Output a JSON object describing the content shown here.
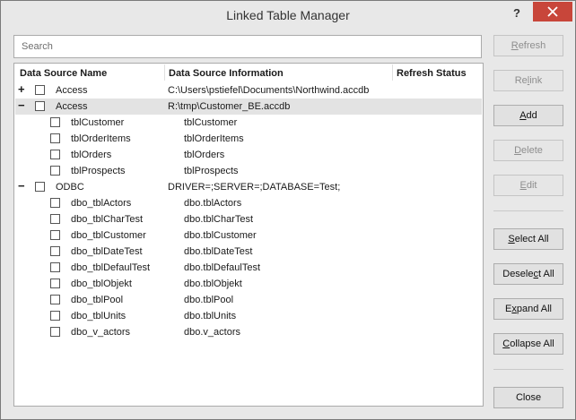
{
  "window": {
    "title": "Linked Table Manager",
    "help": "?"
  },
  "search": {
    "placeholder": "Search"
  },
  "columns": {
    "name": "Data Source Name",
    "info": "Data Source Information",
    "status": "Refresh Status"
  },
  "rows": [
    {
      "expander": "+",
      "name": "Access",
      "info": "C:\\Users\\pstiefel\\Documents\\Northwind.accdb"
    },
    {
      "expander": "−",
      "name": "Access",
      "info": "R:\\tmp\\Customer_BE.accdb",
      "selected": true
    },
    {
      "name": "tblCustomer",
      "info": "tblCustomer"
    },
    {
      "name": "tblOrderItems",
      "info": "tblOrderItems"
    },
    {
      "name": "tblOrders",
      "info": "tblOrders"
    },
    {
      "name": "tblProspects",
      "info": "tblProspects"
    },
    {
      "expander": "−",
      "name": "ODBC",
      "info": "DRIVER=;SERVER=;DATABASE=Test;"
    },
    {
      "name": "dbo_tblActors",
      "info": "dbo.tblActors"
    },
    {
      "name": "dbo_tblCharTest",
      "info": "dbo.tblCharTest"
    },
    {
      "name": "dbo_tblCustomer",
      "info": "dbo.tblCustomer"
    },
    {
      "name": "dbo_tblDateTest",
      "info": "dbo.tblDateTest"
    },
    {
      "name": "dbo_tblDefaulTest",
      "info": "dbo.tblDefaulTest"
    },
    {
      "name": "dbo_tblObjekt",
      "info": "dbo.tblObjekt"
    },
    {
      "name": "dbo_tblPool",
      "info": "dbo.tblPool"
    },
    {
      "name": "dbo_tblUnits",
      "info": "dbo.tblUnits"
    },
    {
      "name": "dbo_v_actors",
      "info": "dbo.v_actors"
    }
  ],
  "buttons": {
    "refresh": {
      "key": "R",
      "rest": "efresh",
      "enabled": false
    },
    "relink": {
      "pre": "Re",
      "key": "l",
      "rest": "ink",
      "enabled": false
    },
    "add": {
      "key": "A",
      "rest": "dd",
      "enabled": true
    },
    "delete": {
      "key": "D",
      "rest": "elete",
      "enabled": false
    },
    "edit": {
      "key": "E",
      "rest": "dit",
      "enabled": false
    },
    "select_all": {
      "key": "S",
      "rest": "elect All"
    },
    "deselect_all": {
      "pre": "Desele",
      "key": "c",
      "rest": "t All"
    },
    "expand_all": {
      "pre": "E",
      "key": "x",
      "rest": "pand All"
    },
    "collapse_all": {
      "key": "C",
      "rest": "ollapse All"
    },
    "close": {
      "label": "Close"
    }
  }
}
